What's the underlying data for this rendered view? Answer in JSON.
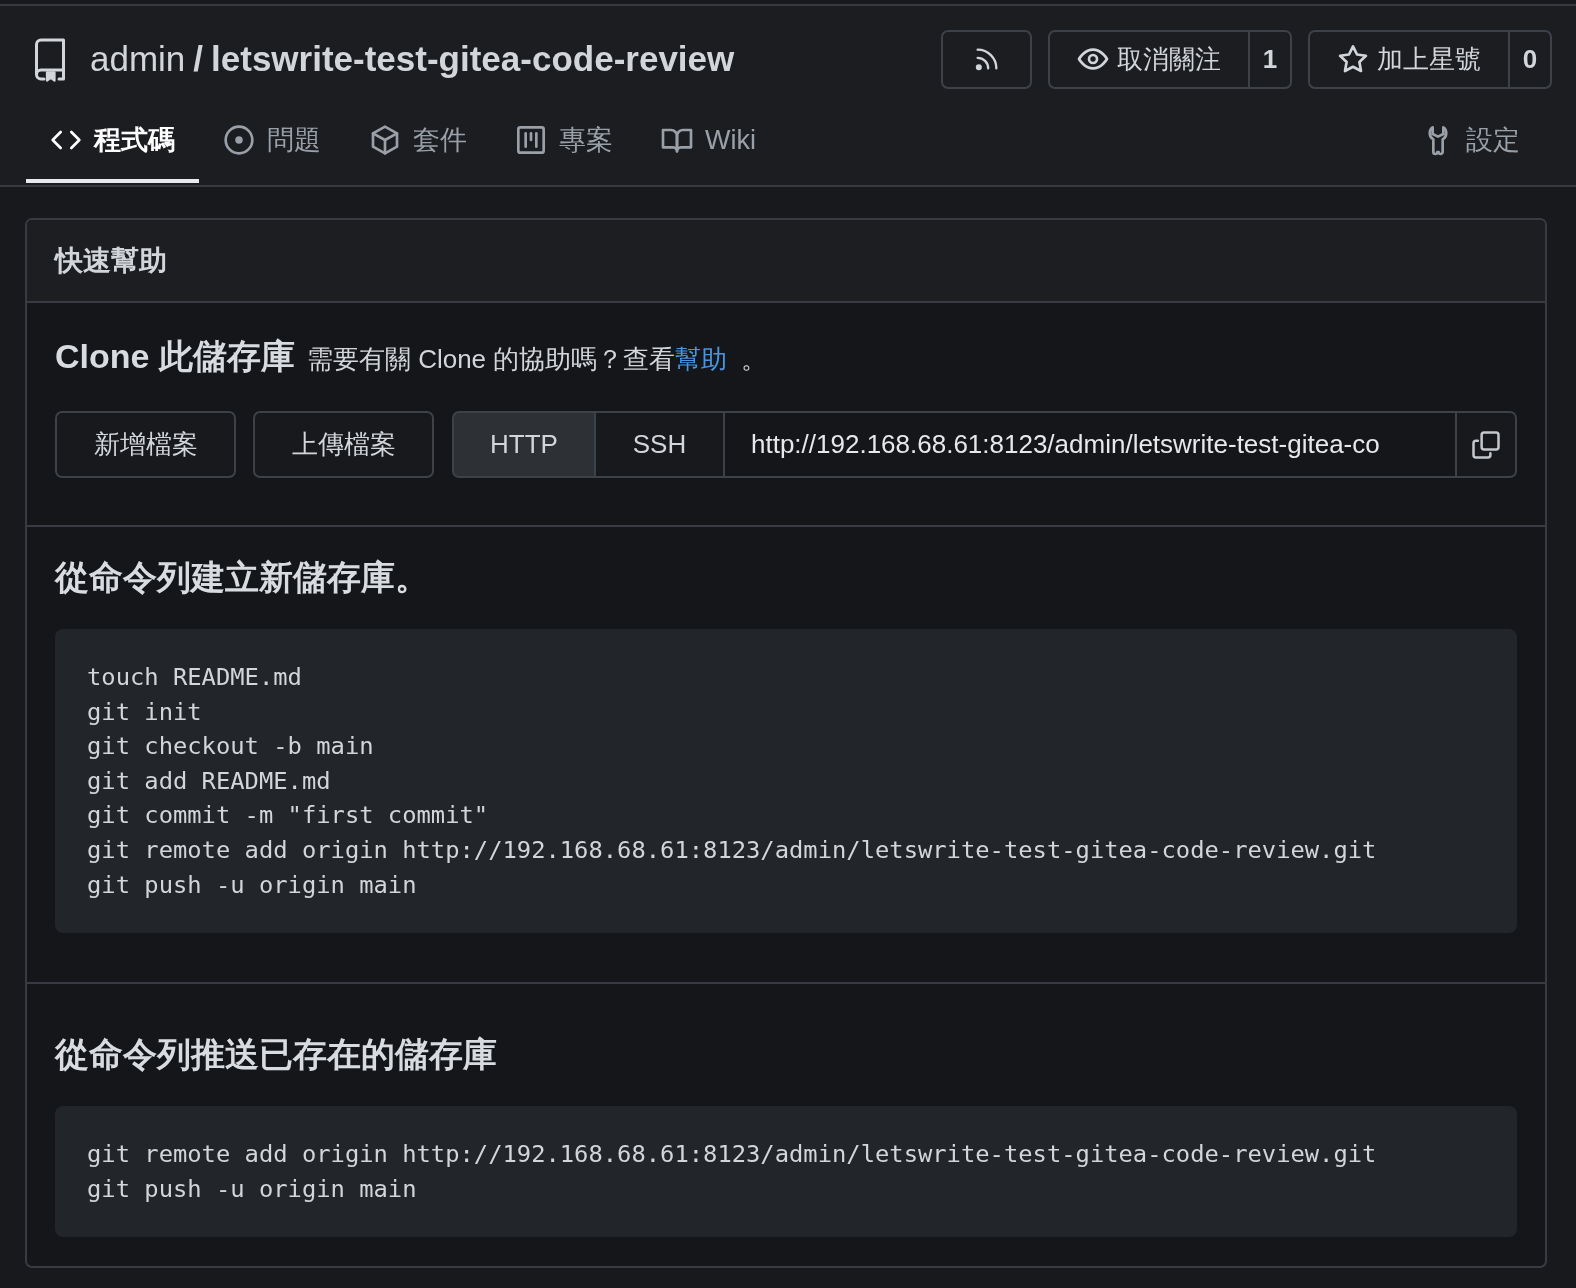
{
  "repo": {
    "owner": "admin",
    "separator": "/",
    "name": "letswrite-test-gitea-code-review"
  },
  "header_actions": [
    {
      "kind": "rss"
    },
    {
      "kind": "watch",
      "label": "取消關注",
      "count": "1"
    },
    {
      "kind": "star",
      "label": "加上星號",
      "count": "0"
    }
  ],
  "tabs": [
    {
      "kind": "code",
      "label": "程式碼",
      "selected": true
    },
    {
      "kind": "issues",
      "label": "問題",
      "selected": false
    },
    {
      "kind": "packages",
      "label": "套件",
      "selected": false
    },
    {
      "kind": "projects",
      "label": "專案",
      "selected": false
    },
    {
      "kind": "wiki",
      "label": "Wiki",
      "selected": false
    },
    {
      "kind": "settings",
      "label": "設定",
      "selected": false
    }
  ],
  "quick_help": {
    "title": "快速幫助",
    "clone": {
      "title": "Clone 此儲存庫",
      "help_text": "需要有關 Clone 的協助嗎？查看",
      "help_link": "幫助",
      "help_end": "。"
    },
    "file_buttons": [
      "新增檔案",
      "上傳檔案"
    ],
    "protocols": [
      {
        "label": "HTTP",
        "selected": true
      },
      {
        "label": "SSH",
        "selected": false
      }
    ],
    "clone_url": "http://192.168.68.61:8123/admin/letswrite-test-gitea-co",
    "sections": [
      {
        "title": "從命令列建立新儲存庫。",
        "code": [
          "touch README.md",
          "git init",
          "git checkout -b main",
          "git add README.md",
          "git commit -m \"first commit\"",
          "git remote add origin http://192.168.68.61:8123/admin/letswrite-test-gitea-code-review.git",
          "git push -u origin main"
        ]
      },
      {
        "title": "從命令列推送已存在的儲存庫",
        "code": [
          "git remote add origin http://192.168.68.61:8123/admin/letswrite-test-gitea-code-review.git",
          "git push -u origin main"
        ]
      }
    ]
  }
}
